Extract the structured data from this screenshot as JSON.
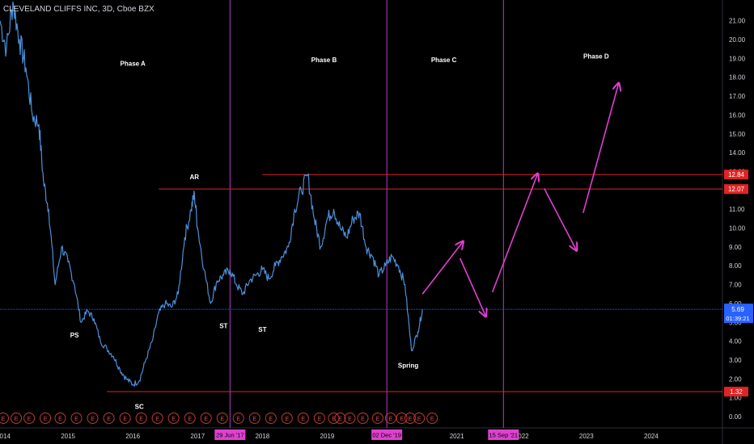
{
  "header": {
    "title": "CLEVELAND CLIFFS INC, 3D, Cboe BZX"
  },
  "colors": {
    "price": "#4a90d9",
    "phase_line": "#b040c0",
    "red_line": "#e02424",
    "arrow": "#e040d0",
    "cur_line": "#2962ff",
    "axis_text": "#d1d4dc",
    "earn": "#c0392b",
    "date_tag_bg": "#e040d0",
    "price_tag_red": "#e02424",
    "price_tag_blue": "#2962ff"
  },
  "chart_data": {
    "type": "line",
    "title": "",
    "xlabel": "",
    "ylabel": "",
    "x_range": [
      2013.95,
      2025.1
    ],
    "ylim": [
      -0.6,
      22.1
    ],
    "y_ticks": [
      0.0,
      1.0,
      2.0,
      3.0,
      4.0,
      5.0,
      6.0,
      7.0,
      8.0,
      9.0,
      10.0,
      11.0,
      12.0,
      13.0,
      14.0,
      15.0,
      16.0,
      17.0,
      18.0,
      19.0,
      20.0,
      21.0
    ],
    "x_ticks": [
      {
        "label": "2014",
        "x": 2014.0
      },
      {
        "label": "2015",
        "x": 2015.0
      },
      {
        "label": "2016",
        "x": 2016.0
      },
      {
        "label": "2017",
        "x": 2017.0
      },
      {
        "label": "2018",
        "x": 2018.0
      },
      {
        "label": "2019",
        "x": 2019.0
      },
      {
        "label": "2021",
        "x": 2021.0
      },
      {
        "label": "2022",
        "x": 2022.0
      },
      {
        "label": "2023",
        "x": 2023.0
      },
      {
        "label": "2024",
        "x": 2024.0
      }
    ],
    "series": [
      {
        "x": [
          2013.95,
          2014.05,
          2014.15,
          2014.25,
          2014.35,
          2014.45,
          2014.55,
          2014.62,
          2014.7,
          2014.8,
          2014.9,
          2015.0,
          2015.1,
          2015.2,
          2015.3,
          2015.4,
          2015.5,
          2015.6,
          2015.7,
          2015.8,
          2015.9,
          2016.0,
          2016.1,
          2016.2,
          2016.3,
          2016.4,
          2016.5,
          2016.6,
          2016.7,
          2016.8,
          2016.9,
          2016.95,
          2017.0,
          2017.1,
          2017.2,
          2017.3,
          2017.4,
          2017.5,
          2017.6,
          2017.7,
          2017.8,
          2017.9,
          2018.0,
          2018.1,
          2018.2,
          2018.3,
          2018.4,
          2018.5,
          2018.6,
          2018.7,
          2018.8,
          2018.9,
          2019.0,
          2019.1,
          2019.2,
          2019.3,
          2019.4,
          2019.5,
          2019.6,
          2019.7,
          2019.8,
          2019.9,
          2020.0,
          2020.1,
          2020.2,
          2020.3,
          2020.4,
          2020.47
        ],
        "values": [
          21.0,
          19.5,
          22.0,
          20.0,
          18.5,
          16.0,
          15.5,
          12.5,
          11.0,
          7.0,
          9.0,
          8.2,
          7.0,
          5.0,
          5.6,
          5.2,
          4.0,
          3.6,
          3.2,
          2.5,
          2.0,
          1.7,
          1.9,
          3.0,
          4.0,
          5.5,
          6.0,
          5.8,
          6.5,
          9.5,
          11.0,
          11.8,
          10.0,
          7.8,
          6.0,
          7.2,
          7.5,
          7.8,
          7.0,
          6.5,
          7.2,
          7.5,
          7.8,
          7.3,
          8.0,
          8.5,
          9.0,
          11.0,
          12.0,
          12.8,
          10.5,
          9.0,
          10.5,
          11.0,
          10.0,
          9.5,
          10.5,
          10.8,
          9.0,
          8.5,
          7.5,
          8.0,
          8.5,
          8.0,
          7.0,
          3.5,
          4.5,
          5.69
        ]
      }
    ],
    "horizontal_levels": [
      {
        "value": 12.84,
        "label": "12.84",
        "x_start": 2018.0
      },
      {
        "value": 12.07,
        "label": "12.07",
        "x_start": 2016.4
      },
      {
        "value": 1.32,
        "label": "1.32",
        "x_start": 2015.6
      }
    ],
    "current_price": {
      "value": 5.69,
      "label": "5.69",
      "countdown": "01:39:21"
    },
    "vertical_lines": [
      {
        "x": 2017.5,
        "label": "29 Jun '17"
      },
      {
        "x": 2019.92,
        "label": "02 Dec '19"
      },
      {
        "x": 2021.72,
        "label": "15 Sep '21"
      }
    ],
    "phases": [
      {
        "label": "Phase A",
        "x": 2016.0,
        "y": 18.6
      },
      {
        "label": "Phase B",
        "x": 2018.95,
        "y": 18.8
      },
      {
        "label": "Phase C",
        "x": 2020.8,
        "y": 18.8
      },
      {
        "label": "Phase D",
        "x": 2023.15,
        "y": 19.0
      }
    ],
    "annotations": [
      {
        "label": "AR",
        "x": 2016.95,
        "y": 12.6
      },
      {
        "label": "PS",
        "x": 2015.1,
        "y": 4.2
      },
      {
        "label": "ST",
        "x": 2017.4,
        "y": 4.7
      },
      {
        "label": "ST",
        "x": 2018.0,
        "y": 4.5
      },
      {
        "label": "SC",
        "x": 2016.1,
        "y": 0.4
      },
      {
        "label": "Spring",
        "x": 2020.25,
        "y": 2.6
      }
    ],
    "projection_arrows": [
      {
        "x1": 2020.47,
        "y1": 6.5,
        "x2": 2021.1,
        "y2": 9.3
      },
      {
        "x1": 2021.05,
        "y1": 8.4,
        "x2": 2021.45,
        "y2": 5.3
      },
      {
        "x1": 2021.55,
        "y1": 6.6,
        "x2": 2022.25,
        "y2": 12.9
      },
      {
        "x1": 2022.35,
        "y1": 12.1,
        "x2": 2022.85,
        "y2": 8.8
      },
      {
        "x1": 2022.95,
        "y1": 10.8,
        "x2": 2023.5,
        "y2": 17.7
      }
    ],
    "earnings_markers": {
      "label": "E",
      "x": [
        2013.85,
        2014.0,
        2014.2,
        2014.4,
        2014.65,
        2014.88,
        2015.13,
        2015.38,
        2015.63,
        2015.88,
        2016.13,
        2016.38,
        2016.63,
        2016.88,
        2017.13,
        2017.38,
        2017.63,
        2017.88,
        2018.13,
        2018.38,
        2018.63,
        2018.88,
        2019.1,
        2019.2,
        2019.35,
        2019.55,
        2019.78,
        2019.98,
        2020.15,
        2020.28,
        2020.42,
        2020.62
      ]
    }
  }
}
